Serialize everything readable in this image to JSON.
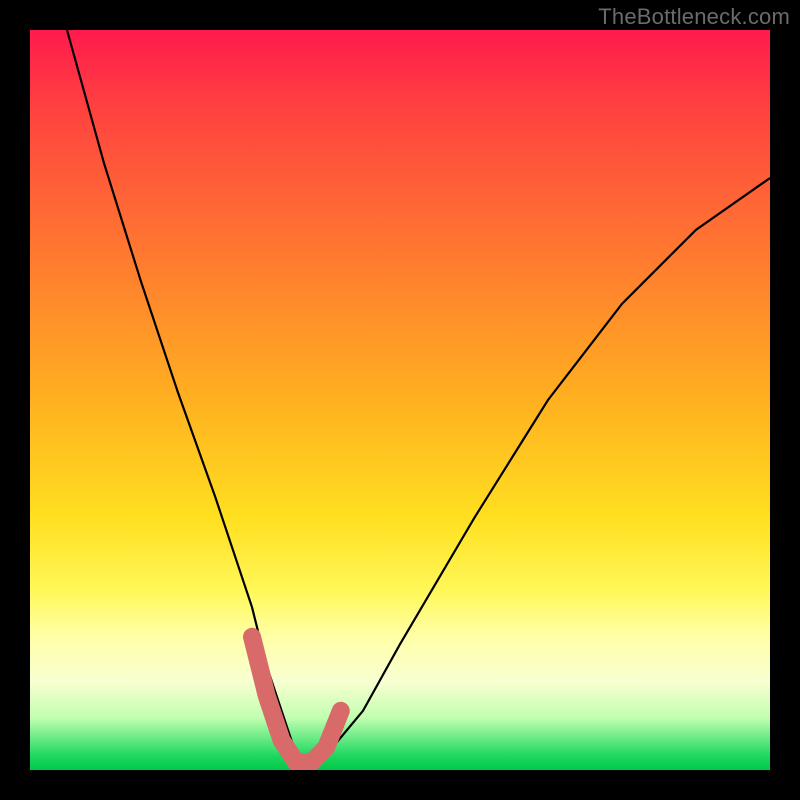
{
  "watermark": "TheBottleneck.com",
  "chart_data": {
    "type": "line",
    "title": "",
    "xlabel": "",
    "ylabel": "",
    "xlim": [
      0,
      100
    ],
    "ylim": [
      0,
      100
    ],
    "series": [
      {
        "name": "bottleneck-curve",
        "x": [
          5,
          10,
          15,
          20,
          25,
          30,
          32,
          34,
          36,
          38,
          40,
          45,
          50,
          60,
          70,
          80,
          90,
          100
        ],
        "values": [
          100,
          82,
          66,
          51,
          37,
          22,
          14,
          8,
          2,
          0,
          2,
          8,
          17,
          34,
          50,
          63,
          73,
          80
        ]
      }
    ],
    "annotations": [
      {
        "name": "highlight-segment",
        "x": [
          30,
          32,
          34,
          36,
          38,
          40,
          42
        ],
        "values": [
          18,
          10,
          4,
          1,
          1,
          3,
          8
        ],
        "color": "#d86a6a"
      }
    ],
    "background_gradient": {
      "top": "#ff1a4d",
      "mid": "#ffe020",
      "bottom": "#00c84a"
    }
  }
}
